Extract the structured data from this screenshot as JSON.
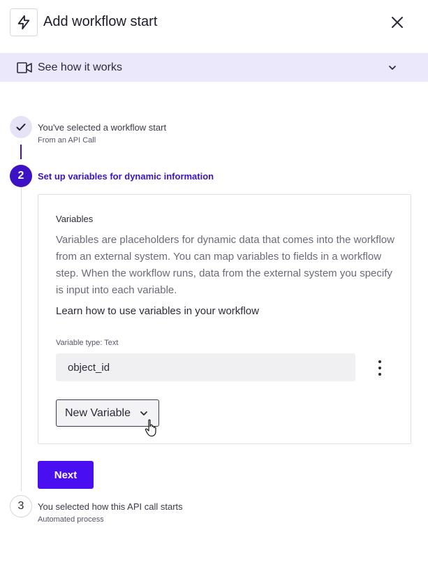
{
  "header": {
    "title": "Add workflow start",
    "icon": "lightning-bolt-icon",
    "close_icon": "close-icon"
  },
  "howto": {
    "label": "See how it works",
    "icon": "video-camera-icon",
    "chevron_icon": "chevron-down-icon",
    "background": "#ebe8fb"
  },
  "steps": [
    {
      "number": "",
      "status": "complete",
      "icon": "checkmark-icon",
      "title": "You've selected a workflow start",
      "subtitle": "From an API Call"
    },
    {
      "number": "2",
      "status": "active",
      "title": "Set up variables for dynamic information"
    },
    {
      "number": "3",
      "status": "pending",
      "title": "You selected how this API call starts",
      "subtitle": "Automated process"
    }
  ],
  "variables_card": {
    "heading": "Variables",
    "description": "Variables are placeholders for dynamic data that comes into the workflow from an external system. You can map variables to fields in a workflow step. When the workflow runs, data from the external system you specify is input into each variable.",
    "learn_link": "Learn how to use variables in your workflow",
    "variable_type_label": "Variable type: Text",
    "variable_value": "object_id",
    "more_icon": "kebab-menu-icon",
    "new_variable_label": "New Variable"
  },
  "next_label": "Next",
  "colors": {
    "accent": "#3d12c4",
    "primary_button": "#4a0ff0"
  }
}
